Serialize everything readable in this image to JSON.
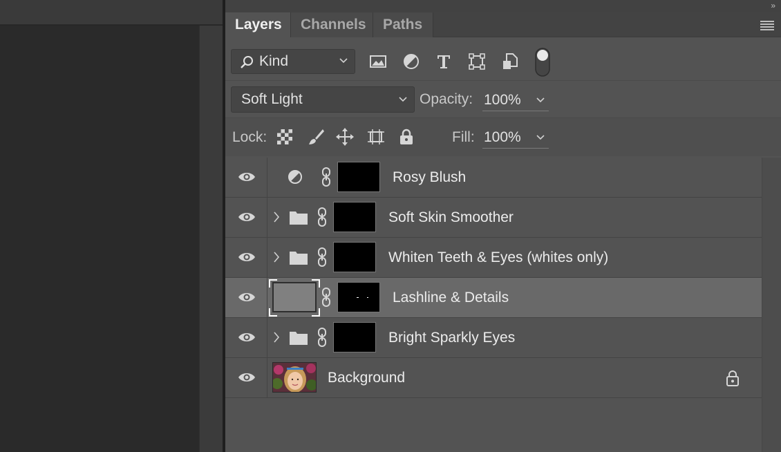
{
  "tabs": [
    {
      "label": "Layers",
      "active": true
    },
    {
      "label": "Channels",
      "active": false
    },
    {
      "label": "Paths",
      "active": false
    }
  ],
  "collapse_label": "»",
  "filter": {
    "kind_label": "Kind",
    "icons": [
      "image-filter-icon",
      "adjustment-filter-icon",
      "type-filter-icon",
      "shape-filter-icon",
      "smart-object-filter-icon",
      "filter-toggle-switch"
    ]
  },
  "blend": {
    "mode": "Soft Light",
    "opacity_label": "Opacity:",
    "opacity_value": "100%"
  },
  "lock": {
    "label": "Lock:",
    "icons": [
      "lock-transparent-pixels-icon",
      "lock-image-pixels-icon",
      "lock-position-icon",
      "lock-artboard-icon",
      "lock-all-icon"
    ],
    "fill_label": "Fill:",
    "fill_value": "100%"
  },
  "layers": [
    {
      "name": "Rosy Blush",
      "type": "adjustment",
      "selected": false
    },
    {
      "name": "Soft Skin Smoother",
      "type": "group",
      "selected": false
    },
    {
      "name": "Whiten Teeth & Eyes (whites only)",
      "type": "group",
      "selected": false
    },
    {
      "name": "Lashline & Details",
      "type": "pixel",
      "selected": true
    },
    {
      "name": "Bright Sparkly Eyes",
      "type": "group",
      "selected": false
    },
    {
      "name": "Background",
      "type": "background",
      "selected": false,
      "locked": true
    }
  ],
  "colors": {
    "panel_bg": "#535353",
    "selected_row": "#696969",
    "text": "#ececec"
  }
}
